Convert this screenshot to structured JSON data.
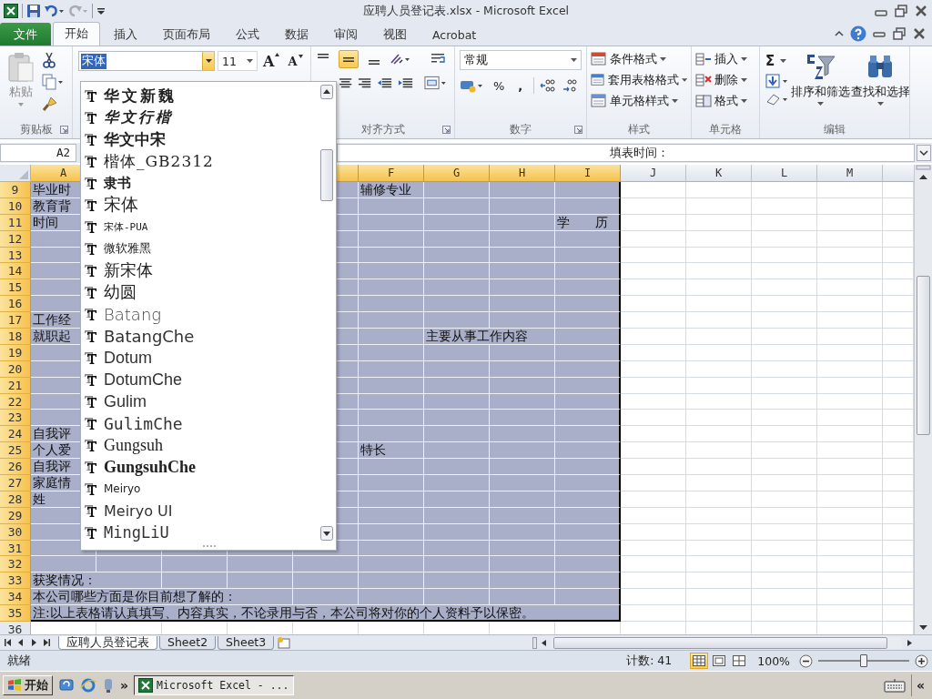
{
  "window": {
    "title": "应聘人员登记表.xlsx - Microsoft Excel"
  },
  "ribbon_tabs": [
    {
      "label": "文件",
      "kind": "file",
      "selected": false
    },
    {
      "label": "开始",
      "kind": "tab",
      "selected": true
    },
    {
      "label": "插入",
      "kind": "tab",
      "selected": false
    },
    {
      "label": "页面布局",
      "kind": "tab",
      "selected": false
    },
    {
      "label": "公式",
      "kind": "tab",
      "selected": false
    },
    {
      "label": "数据",
      "kind": "tab",
      "selected": false
    },
    {
      "label": "审阅",
      "kind": "tab",
      "selected": false
    },
    {
      "label": "视图",
      "kind": "tab",
      "selected": false
    },
    {
      "label": "Acrobat",
      "kind": "tab",
      "selected": false
    }
  ],
  "ribbon": {
    "clipboard": {
      "label": "剪贴板",
      "paste": "粘贴"
    },
    "font": {
      "name": "宋体",
      "size": "11",
      "grow": "A",
      "shrink": "A"
    },
    "alignment": {
      "label": "对齐方式",
      "vertical": [
        {
          "selected": false
        },
        {
          "selected": true
        },
        {
          "selected": false
        }
      ]
    },
    "number": {
      "label": "数字",
      "format": "常规",
      "percent": "%",
      "comma": ","
    },
    "styles": {
      "label": "样式",
      "items": [
        "条件格式",
        "套用表格格式",
        "单元格样式"
      ]
    },
    "cells": {
      "label": "单元格",
      "items": [
        "插入",
        "删除",
        "格式"
      ]
    },
    "editing": {
      "label": "编辑",
      "sum": "Σ",
      "sort": "排序和筛选",
      "find": "查找和选择"
    }
  },
  "formula_bar": {
    "name_box": "A2",
    "content": "填表时间："
  },
  "font_dropdown": {
    "items": [
      "华文新魏",
      "华文行楷",
      "华文中宋",
      "楷体_GB2312",
      "隶书",
      "宋体",
      "宋体-PUA",
      "微软雅黑",
      "新宋体",
      "幼圆",
      "Batang",
      "BatangChe",
      "Dotum",
      "DotumChe",
      "Gulim",
      "GulimChe",
      "Gungsuh",
      "GungsuhChe",
      "Meiryo",
      "Meiryo UI",
      "MingLiU"
    ]
  },
  "sheet": {
    "columns": [
      {
        "label": "A",
        "selected": true
      },
      {
        "label": "F",
        "selected": true
      },
      {
        "label": "G",
        "selected": true
      },
      {
        "label": "H",
        "selected": true
      },
      {
        "label": "I",
        "selected": true
      },
      {
        "label": "J",
        "selected": false
      },
      {
        "label": "K",
        "selected": false
      },
      {
        "label": "L",
        "selected": false
      },
      {
        "label": "M",
        "selected": false
      }
    ],
    "rows": [
      {
        "header": "9",
        "selected": true,
        "column_a": "毕业时",
        "column_f": "辅修专业"
      },
      {
        "header": "10",
        "selected": true,
        "column_a": "教育背"
      },
      {
        "header": "11",
        "selected": true,
        "column_a": "时间",
        "column_i": "学　　历"
      },
      {
        "header": "12",
        "selected": true
      },
      {
        "header": "13",
        "selected": true
      },
      {
        "header": "14",
        "selected": true
      },
      {
        "header": "15",
        "selected": true
      },
      {
        "header": "16",
        "selected": true
      },
      {
        "header": "17",
        "selected": true,
        "column_a": "工作经"
      },
      {
        "header": "18",
        "selected": true,
        "column_a": "就职起",
        "column_g": "主要从事工作内容"
      },
      {
        "header": "19",
        "selected": true
      },
      {
        "header": "20",
        "selected": true
      },
      {
        "header": "21",
        "selected": true
      },
      {
        "header": "22",
        "selected": true
      },
      {
        "header": "23",
        "selected": true
      },
      {
        "header": "24",
        "selected": true,
        "column_a": "自我评"
      },
      {
        "header": "25",
        "selected": true,
        "column_a": "个人爱",
        "column_f": "特长"
      },
      {
        "header": "26",
        "selected": true,
        "column_a": "自我评"
      },
      {
        "header": "27",
        "selected": true,
        "column_a": "家庭情"
      },
      {
        "header": "28",
        "selected": true,
        "column_a": "姓"
      },
      {
        "header": "29",
        "selected": true
      },
      {
        "header": "30",
        "selected": true
      },
      {
        "header": "31",
        "selected": true
      },
      {
        "header": "32",
        "selected": true
      },
      {
        "header": "33",
        "selected": true,
        "column_a": "获奖情况："
      },
      {
        "header": "34",
        "selected": true,
        "column_a": "本公司哪些方面是你目前想了解的："
      },
      {
        "header": "35",
        "selected": true,
        "column_a": "注:以上表格请认真填写、内容真实，不论录用与否，本公司将对你的个人资料予以保密。"
      },
      {
        "header": "36",
        "selected": false
      }
    ]
  },
  "sheet_tabs": [
    {
      "label": "应聘人员登记表",
      "selected": true
    },
    {
      "label": "Sheet2",
      "selected": false
    },
    {
      "label": "Sheet3",
      "selected": false
    }
  ],
  "status_bar": {
    "mode": "就绪",
    "count": "计数: 41",
    "views": [
      {
        "selected": true
      },
      {
        "selected": false
      },
      {
        "selected": false
      }
    ],
    "zoom": "100%",
    "zoom_slider": {
      "level": 0.5
    }
  },
  "taskbar": {
    "start": "开始",
    "overflow": "»",
    "task": "Microsoft Excel - ...",
    "tray_overflow": "«"
  }
}
